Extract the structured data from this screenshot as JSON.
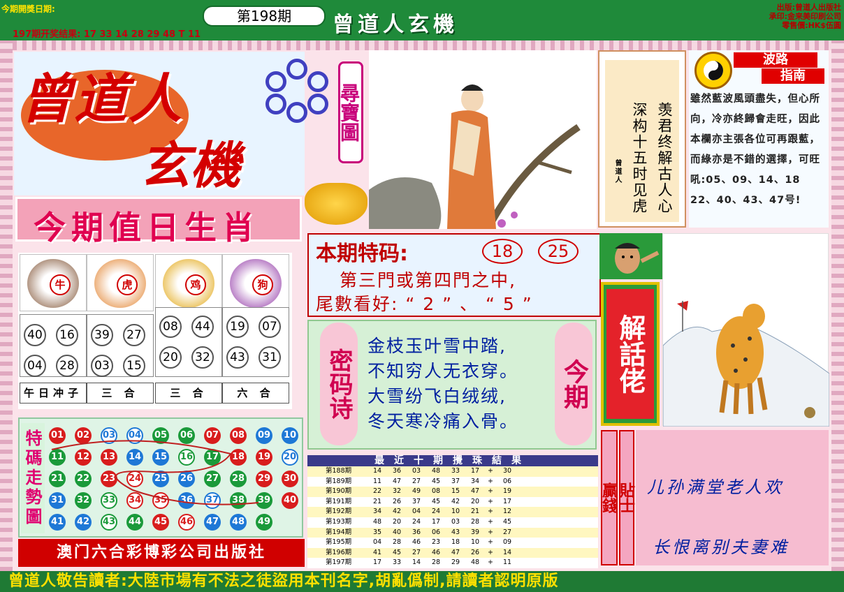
{
  "header": {
    "date_label": "今期開獎日期:",
    "issue": "第198期",
    "banner_title": "曾道人玄機",
    "prev_result": "197期开奖结果: 17 33 14 28 29 48 T 11",
    "publisher_lines": [
      "出版:曾道人出版社",
      "承印:金来美印刷公司",
      "零售價:HK$伍圓"
    ]
  },
  "logo": {
    "line1": "曾道人",
    "line2": "玄機",
    "side_label": "尋寶圖"
  },
  "poem": {
    "col1": "羡君终解古人心",
    "col2": "深构十五时见虎",
    "signature": "曾道人"
  },
  "wave": {
    "title1": "波路",
    "title2": "指南",
    "text": "雖然藍波風頭盡失，但心所向，冷亦終歸會走旺，因此本欄亦主張各位可再跟藍，而綠亦是不錯的選擇，可旺吼:05、09、14、18 22、40、43、47号!"
  },
  "zodiac": {
    "heading": "今期值日生肖",
    "cells": [
      {
        "name": "牛",
        "numbers": [
          "40",
          "16",
          "04",
          "28"
        ],
        "label": "午日冲子"
      },
      {
        "name": "虎",
        "numbers": [
          "39",
          "27",
          "03",
          "15"
        ],
        "label": "三 合"
      },
      {
        "name": "鸡",
        "numbers": [
          "08",
          "44",
          "20",
          "32"
        ],
        "label": "三 合"
      },
      {
        "name": "狗",
        "numbers": [
          "19",
          "07",
          "43",
          "31"
        ],
        "label": "六 合"
      }
    ]
  },
  "trend": {
    "label": "特碼走勢圖",
    "balls": [
      [
        "01",
        "r"
      ],
      [
        "02",
        "r"
      ],
      [
        "03",
        "b"
      ],
      [
        "04",
        "b"
      ],
      [
        "05",
        "g"
      ],
      [
        "06",
        "g"
      ],
      [
        "07",
        "r"
      ],
      [
        "08",
        "r"
      ],
      [
        "09",
        "b"
      ],
      [
        "10",
        "b"
      ],
      [
        "11",
        "g"
      ],
      [
        "12",
        "r"
      ],
      [
        "13",
        "r"
      ],
      [
        "14",
        "b"
      ],
      [
        "15",
        "b"
      ],
      [
        "16",
        "g"
      ],
      [
        "17",
        "g"
      ],
      [
        "18",
        "r"
      ],
      [
        "19",
        "r"
      ],
      [
        "20",
        "b"
      ],
      [
        "21",
        "g"
      ],
      [
        "22",
        "g"
      ],
      [
        "23",
        "r"
      ],
      [
        "24",
        "r"
      ],
      [
        "25",
        "b"
      ],
      [
        "26",
        "b"
      ],
      [
        "27",
        "g"
      ],
      [
        "28",
        "g"
      ],
      [
        "29",
        "r"
      ],
      [
        "30",
        "r"
      ],
      [
        "31",
        "b"
      ],
      [
        "32",
        "g"
      ],
      [
        "33",
        "g"
      ],
      [
        "34",
        "r"
      ],
      [
        "35",
        "r"
      ],
      [
        "36",
        "b"
      ],
      [
        "37",
        "b"
      ],
      [
        "38",
        "g"
      ],
      [
        "39",
        "g"
      ],
      [
        "40",
        "r"
      ],
      [
        "41",
        "b"
      ],
      [
        "42",
        "b"
      ],
      [
        "43",
        "g"
      ],
      [
        "44",
        "g"
      ],
      [
        "45",
        "r"
      ],
      [
        "46",
        "r"
      ],
      [
        "47",
        "b"
      ],
      [
        "48",
        "b"
      ],
      [
        "49",
        "g"
      ]
    ],
    "highlighted": [
      "03",
      "04",
      "16",
      "20",
      "24",
      "33",
      "34",
      "35",
      "37",
      "43",
      "46"
    ],
    "colors": {
      "r": "#d81d1d",
      "b": "#1e78d6",
      "g": "#1a9a3a"
    }
  },
  "macau": "澳门六合彩博彩公司出版社",
  "special": {
    "title": "本期特码:",
    "num1": "18",
    "num2": "25",
    "line1": "第三門或第四門之中,",
    "line2": "尾數看好: “ 2 ” 、 “ 5 ”"
  },
  "code_poem": {
    "left": "密码诗",
    "right": "今期",
    "lines": [
      "金枝玉叶雪中踏,",
      "不知穷人无衣穿。",
      "大雪纷飞白绒绒,",
      "冬天寒冷痛入骨。"
    ]
  },
  "results": {
    "heading": "最近十期攪珠結果",
    "rows": [
      [
        "第188期",
        "14",
        "36",
        "03",
        "48",
        "33",
        "17",
        "+",
        "30"
      ],
      [
        "第189期",
        "11",
        "47",
        "27",
        "45",
        "37",
        "34",
        "+",
        "06"
      ],
      [
        "第190期",
        "22",
        "32",
        "49",
        "08",
        "15",
        "47",
        "+",
        "19"
      ],
      [
        "第191期",
        "21",
        "26",
        "37",
        "45",
        "42",
        "20",
        "+",
        "17"
      ],
      [
        "第192期",
        "34",
        "42",
        "04",
        "24",
        "10",
        "21",
        "+",
        "12"
      ],
      [
        "第193期",
        "48",
        "20",
        "24",
        "17",
        "03",
        "28",
        "+",
        "45"
      ],
      [
        "第194期",
        "35",
        "40",
        "36",
        "06",
        "43",
        "39",
        "+",
        "27"
      ],
      [
        "第195期",
        "04",
        "28",
        "46",
        "23",
        "18",
        "10",
        "+",
        "09"
      ],
      [
        "第196期",
        "41",
        "45",
        "27",
        "46",
        "47",
        "26",
        "+",
        "14"
      ],
      [
        "第197期",
        "17",
        "33",
        "14",
        "28",
        "29",
        "48",
        "+",
        "11"
      ]
    ]
  },
  "jiehua": "解話佬",
  "tips": {
    "label1": "贏錢",
    "label2": "貼士",
    "line1": "儿孙满堂老人欢",
    "line2": "长恨离别夫妻难"
  },
  "footer": "曾道人敬告讀者:大陸市場有不法之徒盜用本刊名字,胡亂僞制,請讀者認明原版"
}
